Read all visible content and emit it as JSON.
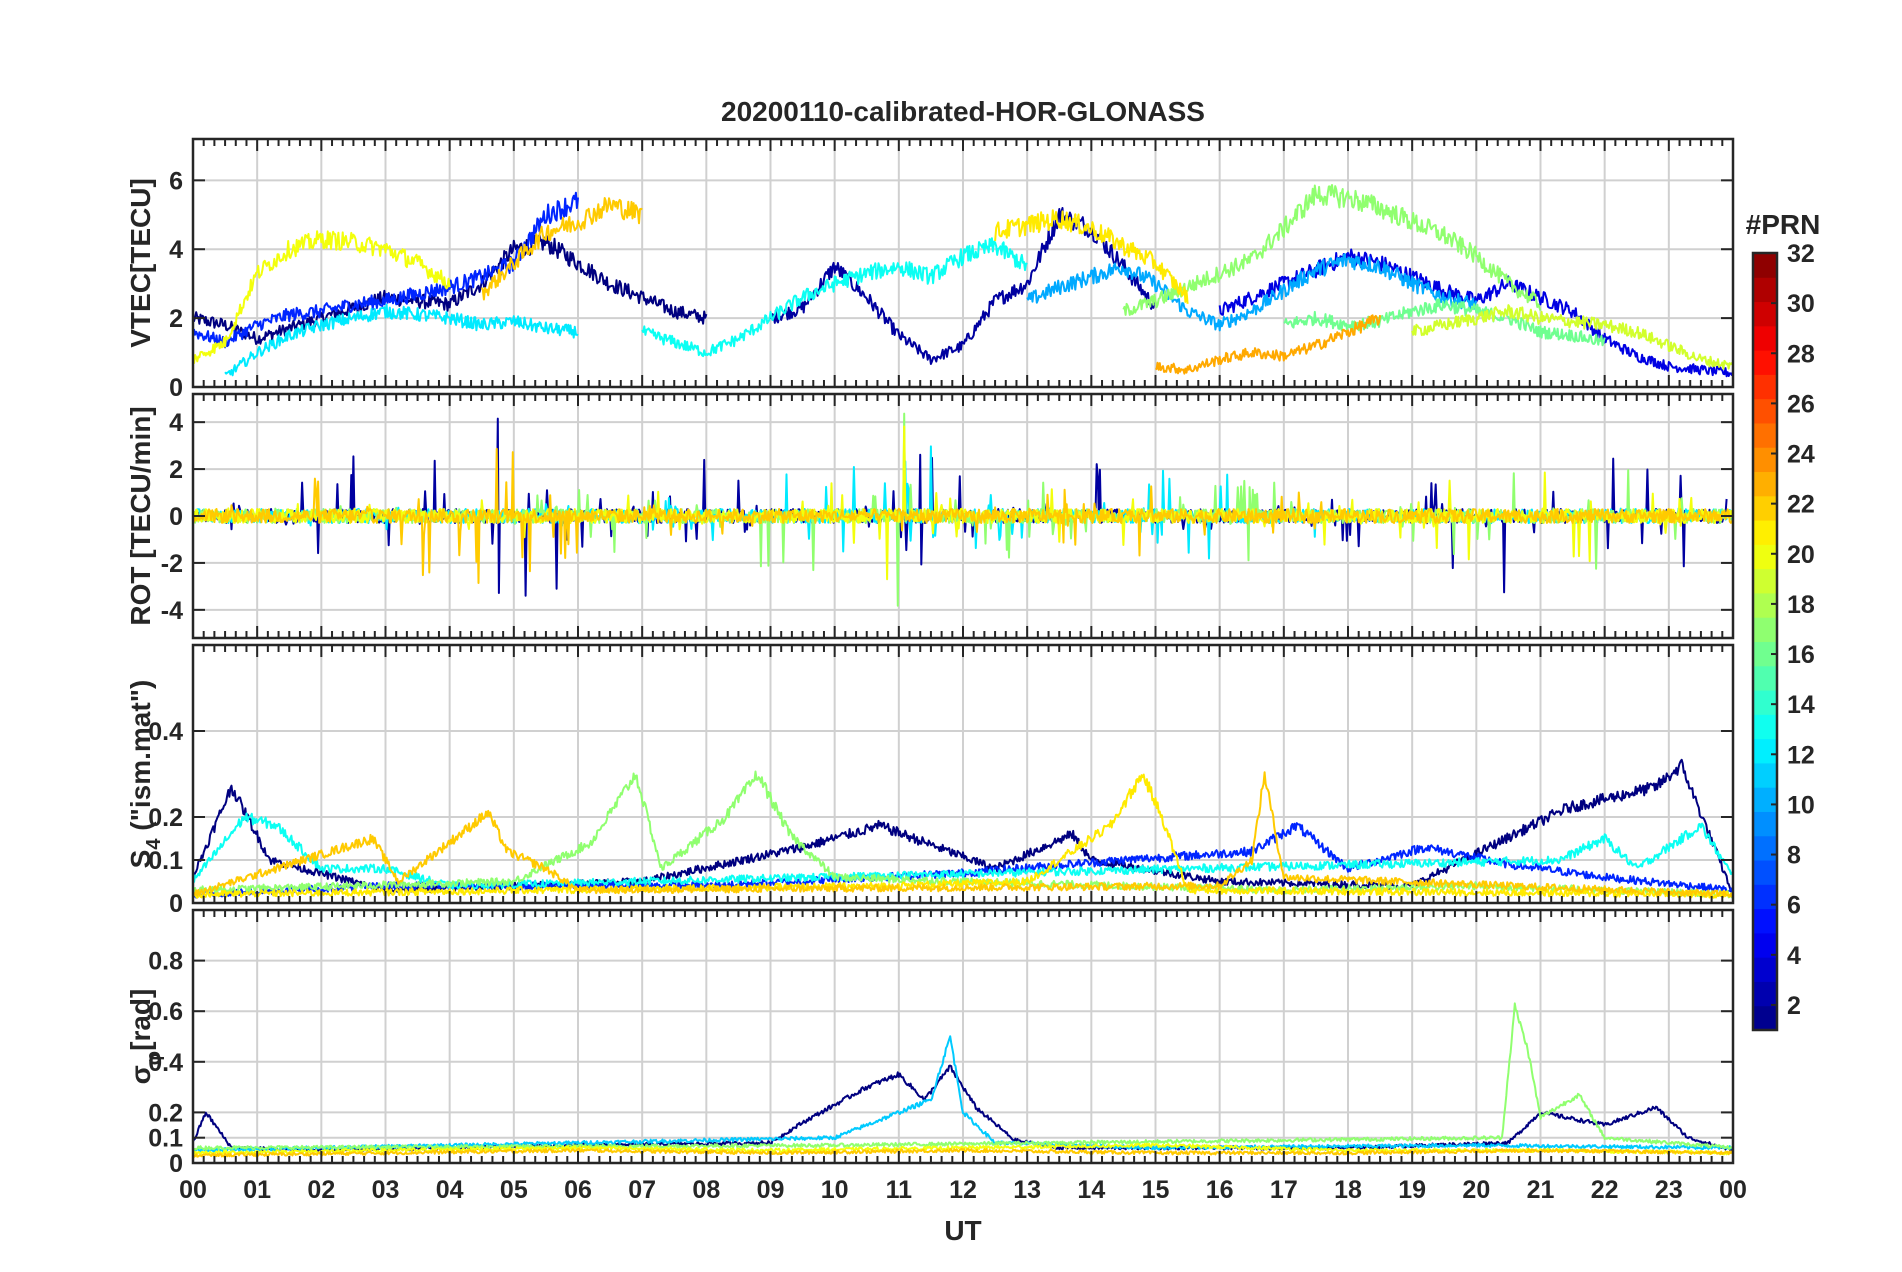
{
  "chart_data": {
    "type": "line",
    "title": "20200110-calibrated-HOR-GLONASS",
    "xlabel": "UT",
    "x_tick_labels": [
      "00",
      "01",
      "02",
      "03",
      "04",
      "05",
      "06",
      "07",
      "08",
      "09",
      "10",
      "11",
      "12",
      "13",
      "14",
      "15",
      "16",
      "17",
      "18",
      "19",
      "20",
      "21",
      "22",
      "23",
      "00"
    ],
    "xlim": [
      0,
      24
    ],
    "grid": true,
    "colorbar": {
      "title": "#PRN",
      "range": [
        1,
        32
      ],
      "tick_labels": [
        "2",
        "4",
        "6",
        "8",
        "10",
        "12",
        "14",
        "16",
        "18",
        "20",
        "22",
        "24",
        "26",
        "28",
        "30",
        "32"
      ],
      "tick_values": [
        2,
        4,
        6,
        8,
        10,
        12,
        14,
        16,
        18,
        20,
        22,
        24,
        26,
        28,
        30,
        32
      ],
      "colormap": "jet",
      "placement": "right"
    },
    "panels": [
      {
        "ylabel": "VTEC[TECU]",
        "ylim": [
          0,
          7.2
        ],
        "y_ticks": [
          0,
          2,
          4,
          6
        ],
        "y_tick_labels": [
          "0",
          "2",
          "4",
          "6"
        ],
        "series": [
          {
            "prn": 1,
            "x": [
              0,
              0.5,
              1,
              1.5,
              2,
              2.5,
              3,
              3.5,
              4,
              4.5,
              5,
              5.5,
              6,
              6.5,
              7,
              7.5,
              8
            ],
            "values": [
              2.0,
              1.8,
              1.4,
              1.7,
              2.0,
              2.3,
              2.6,
              2.5,
              2.4,
              3.0,
              4.0,
              4.2,
              3.6,
              3.0,
              2.6,
              2.2,
              2.0
            ]
          },
          {
            "prn": 2,
            "x": [
              9,
              9.5,
              10,
              10.5,
              11,
              11.5,
              12,
              12.5,
              13,
              13.5,
              14,
              14.5,
              15
            ],
            "values": [
              2.0,
              2.3,
              3.5,
              2.6,
              1.5,
              0.8,
              1.2,
              2.5,
              3.0,
              5.0,
              4.6,
              3.5,
              2.3
            ]
          },
          {
            "prn": 4,
            "x": [
              16,
              16.5,
              17,
              17.5,
              18,
              18.5,
              19,
              19.5,
              20,
              20.5,
              21,
              21.5,
              22,
              22.5,
              23,
              23.5,
              24
            ],
            "values": [
              2.2,
              2.6,
              3.0,
              3.4,
              3.8,
              3.6,
              3.2,
              2.8,
              2.5,
              3.0,
              2.6,
              2.2,
              1.4,
              0.9,
              0.6,
              0.5,
              0.4
            ]
          },
          {
            "prn": 6,
            "x": [
              0,
              0.5,
              1,
              1.5,
              2,
              2.5,
              3,
              3.5,
              4,
              4.5,
              5,
              5.5,
              6
            ],
            "values": [
              1.6,
              1.3,
              1.8,
              2.1,
              2.2,
              2.4,
              2.5,
              2.7,
              2.9,
              3.2,
              3.6,
              5.0,
              5.4
            ]
          },
          {
            "prn": 10,
            "x": [
              13,
              13.5,
              14,
              14.5,
              15,
              15.5,
              16,
              16.5,
              17,
              17.5,
              18,
              18.5,
              19,
              19.5,
              20
            ],
            "values": [
              2.5,
              2.9,
              3.2,
              3.5,
              3.0,
              2.2,
              1.8,
              2.2,
              2.8,
              3.4,
              3.7,
              3.5,
              3.0,
              2.6,
              2.4
            ]
          },
          {
            "prn": 12,
            "x": [
              0.5,
              1,
              1.5,
              2,
              2.5,
              3,
              3.5,
              4,
              4.5,
              5,
              5.5,
              6
            ],
            "values": [
              0.3,
              1.0,
              1.5,
              1.8,
              2.0,
              2.2,
              2.1,
              2.0,
              1.8,
              1.9,
              1.7,
              1.6
            ]
          },
          {
            "prn": 13,
            "x": [
              7,
              7.5,
              8,
              8.5,
              9,
              9.5,
              10,
              10.5,
              11,
              11.5,
              12,
              12.5,
              13
            ],
            "values": [
              1.6,
              1.3,
              1.0,
              1.4,
              2.0,
              2.6,
              3.0,
              3.3,
              3.5,
              3.2,
              3.8,
              4.1,
              3.5
            ]
          },
          {
            "prn": 16,
            "x": [
              17,
              17.5,
              18,
              18.5,
              19,
              19.5,
              20,
              20.5,
              21,
              21.5,
              22
            ],
            "values": [
              1.8,
              2.0,
              1.8,
              1.9,
              2.2,
              2.4,
              2.2,
              2.0,
              1.6,
              1.5,
              1.3
            ]
          },
          {
            "prn": 17,
            "x": [
              14.5,
              15,
              15.5,
              16,
              16.5,
              17,
              17.5,
              18,
              18.5,
              19,
              19.5,
              20,
              20.5,
              21
            ],
            "values": [
              2.2,
              2.5,
              2.9,
              3.3,
              3.7,
              4.6,
              5.6,
              5.5,
              5.2,
              4.8,
              4.4,
              3.8,
              3.0,
              2.4
            ]
          },
          {
            "prn": 19,
            "x": [
              19,
              19.5,
              20,
              20.5,
              21,
              21.5,
              22,
              22.5,
              23,
              23.5,
              24
            ],
            "values": [
              1.6,
              1.8,
              2.0,
              2.2,
              2.0,
              1.9,
              1.8,
              1.6,
              1.2,
              0.8,
              0.6
            ]
          },
          {
            "prn": 20,
            "x": [
              0,
              0.5,
              1,
              1.5,
              2,
              2.5,
              3,
              3.5,
              4
            ],
            "values": [
              0.8,
              1.3,
              3.3,
              4.0,
              4.3,
              4.2,
              4.0,
              3.6,
              3.0
            ]
          },
          {
            "prn": 21,
            "x": [
              12.5,
              13,
              13.5,
              14,
              14.5,
              15,
              15.5
            ],
            "values": [
              4.5,
              4.7,
              4.9,
              4.6,
              4.1,
              3.6,
              2.6
            ]
          },
          {
            "prn": 22,
            "x": [
              4.5,
              5,
              5.5,
              6,
              6.5,
              7
            ],
            "values": [
              2.7,
              3.6,
              4.5,
              4.8,
              5.3,
              5.0
            ]
          },
          {
            "prn": 23,
            "x": [
              15,
              15.5,
              16,
              16.5,
              17,
              17.5,
              18,
              18.5
            ],
            "values": [
              0.6,
              0.5,
              0.8,
              1.0,
              0.9,
              1.2,
              1.6,
              2.0
            ]
          }
        ]
      },
      {
        "ylabel": "ROT [TECU/min]",
        "ylim": [
          -5.2,
          5.2
        ],
        "y_ticks": [
          -4,
          -2,
          0,
          2,
          4
        ],
        "y_tick_labels": [
          "-4",
          "-2",
          "0",
          "2",
          "4"
        ],
        "series": [
          {
            "prn": 2,
            "x": [
              0,
              5.2,
              8,
              10.1,
              11.4,
              11.9,
              13.6,
              20.6,
              21.4,
              23.9
            ],
            "values": [
              0,
              4.8,
              -3.8,
              3.2,
              -3.8,
              2.2,
              -2.8,
              3.8,
              -3.4,
              -1.6
            ]
          },
          {
            "prn": 12,
            "x": [
              0,
              3,
              7,
              11.6,
              12.1,
              14.8,
              16,
              19,
              22.5,
              24
            ],
            "values": [
              0,
              0.4,
              -0.6,
              -4.0,
              2.0,
              -1.5,
              -2.6,
              0.6,
              -0.3,
              0
            ]
          },
          {
            "prn": 17,
            "x": [
              0,
              4,
              6.5,
              8.8,
              11.3,
              12.5,
              16.5,
              20.8,
              21.8,
              24
            ],
            "values": [
              0,
              0.3,
              -2.0,
              2.2,
              4.3,
              -2.2,
              1.8,
              -2.6,
              2.4,
              0
            ]
          },
          {
            "prn": 20,
            "x": [
              0,
              2.5,
              5,
              6.8,
              9.5,
              11.1,
              13,
              14.5,
              16,
              21.2,
              24
            ],
            "values": [
              0,
              0.4,
              -1.0,
              1.6,
              -1.0,
              -4.2,
              3.0,
              -1.3,
              0.6,
              2.4,
              0
            ]
          },
          {
            "prn": 22,
            "x": [
              0,
              5.3,
              5.6,
              6.4,
              15.8,
              16.3,
              18,
              24
            ],
            "values": [
              0,
              -4.5,
              2.4,
              1.2,
              -2.0,
              1.4,
              0.2,
              0
            ]
          }
        ]
      },
      {
        "ylabel": "S_4 (\"ism.mat\")",
        "ylim": [
          0,
          0.6
        ],
        "y_ticks": [
          0,
          0.1,
          0.2,
          0.4
        ],
        "y_tick_labels": [
          "0",
          "0.1",
          "0.2",
          "0.4"
        ],
        "series": [
          {
            "prn": 1,
            "x": [
              0,
              0.6,
              1.2,
              3,
              7,
              9.5,
              10.7,
              12.5,
              13.7,
              14,
              16,
              19,
              21.4,
              22.8,
              23.2,
              24
            ],
            "values": [
              0.06,
              0.27,
              0.1,
              0.03,
              0.05,
              0.13,
              0.18,
              0.08,
              0.16,
              0.1,
              0.05,
              0.04,
              0.22,
              0.27,
              0.32,
              0.02
            ]
          },
          {
            "prn": 6,
            "x": [
              0,
              3,
              8,
              12,
              14.5,
              16.5,
              17.2,
              18,
              19.2,
              20.5,
              22,
              24
            ],
            "values": [
              0.02,
              0.04,
              0.04,
              0.07,
              0.1,
              0.12,
              0.18,
              0.08,
              0.13,
              0.09,
              0.06,
              0.03
            ]
          },
          {
            "prn": 13,
            "x": [
              0,
              0.8,
              1.3,
              2,
              3,
              3.5,
              4,
              21.3,
              22,
              22.5,
              23.5,
              24
            ],
            "values": [
              0.05,
              0.2,
              0.18,
              0.08,
              0.08,
              0.06,
              0.04,
              0.1,
              0.15,
              0.08,
              0.18,
              0.06
            ]
          },
          {
            "prn": 17,
            "x": [
              0,
              5,
              6.2,
              6.9,
              7.3,
              8.3,
              8.8,
              9.3,
              10,
              12,
              17,
              20,
              24
            ],
            "values": [
              0.03,
              0.05,
              0.14,
              0.3,
              0.08,
              0.2,
              0.3,
              0.16,
              0.06,
              0.05,
              0.03,
              0.04,
              0.02
            ]
          },
          {
            "prn": 21,
            "x": [
              0,
              11,
              13,
              14.3,
              14.8,
              15.1,
              15.5,
              24
            ],
            "values": [
              0.02,
              0.04,
              0.05,
              0.18,
              0.3,
              0.2,
              0.03,
              0.02
            ]
          },
          {
            "prn": 22,
            "x": [
              0,
              2.8,
              3.2,
              4.6,
              4.9,
              5.5,
              6,
              16,
              16.5,
              16.7,
              17,
              24
            ],
            "values": [
              0.02,
              0.15,
              0.05,
              0.21,
              0.12,
              0.08,
              0.03,
              0.04,
              0.1,
              0.3,
              0.06,
              0.02
            ]
          }
        ]
      },
      {
        "ylabel": "σ_φ[rad]",
        "ylim": [
          0,
          1.0
        ],
        "y_ticks": [
          0,
          0.1,
          0.2,
          0.4,
          0.6,
          0.8
        ],
        "y_tick_labels": [
          "0",
          "0.1",
          "0.2",
          "0.4",
          "0.6",
          "0.8"
        ],
        "series": [
          {
            "prn": 1,
            "x": [
              0,
              0.2,
              0.6,
              2,
              6,
              9,
              9.5,
              10.5,
              11,
              11.4,
              11.8,
              12.2,
              12.8,
              13.5,
              18,
              20.5,
              21,
              22,
              22.8,
              23.3,
              24
            ],
            "values": [
              0.08,
              0.2,
              0.06,
              0.05,
              0.07,
              0.08,
              0.16,
              0.3,
              0.35,
              0.25,
              0.38,
              0.22,
              0.09,
              0.06,
              0.06,
              0.08,
              0.2,
              0.15,
              0.22,
              0.1,
              0.05
            ]
          },
          {
            "prn": 11,
            "x": [
              0,
              4,
              10,
              11.5,
              11.8,
              12,
              12.5,
              15,
              20,
              24
            ],
            "values": [
              0.05,
              0.07,
              0.1,
              0.25,
              0.5,
              0.2,
              0.08,
              0.06,
              0.07,
              0.06
            ]
          },
          {
            "prn": 17,
            "x": [
              0,
              10,
              20.4,
              20.6,
              20.8,
              21,
              21.6,
              22,
              24
            ],
            "values": [
              0.06,
              0.07,
              0.1,
              0.62,
              0.45,
              0.18,
              0.27,
              0.1,
              0.06
            ]
          },
          {
            "prn": 20,
            "x": [
              0,
              3,
              6,
              9,
              12,
              15,
              18,
              21,
              24
            ],
            "values": [
              0.04,
              0.05,
              0.06,
              0.05,
              0.06,
              0.07,
              0.05,
              0.05,
              0.04
            ]
          },
          {
            "prn": 22,
            "x": [
              0,
              3,
              6,
              9,
              12,
              15,
              18,
              21,
              24
            ],
            "values": [
              0.03,
              0.04,
              0.05,
              0.04,
              0.05,
              0.04,
              0.04,
              0.05,
              0.04
            ]
          }
        ]
      }
    ]
  }
}
